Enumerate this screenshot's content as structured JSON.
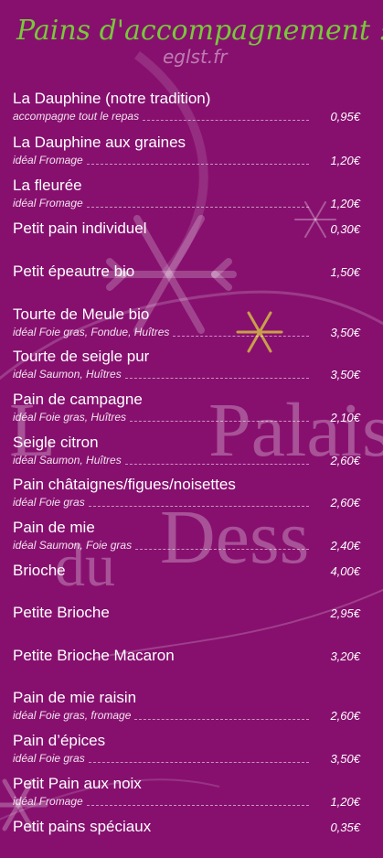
{
  "header": {
    "title": "Pains d'accompagnement :",
    "watermark": "eglst.fr"
  },
  "background_text": {
    "line1": "Palais",
    "line2": "du",
    "line3": "Dess"
  },
  "colors": {
    "background": "#87106f",
    "title": "#78c83a",
    "text": "#ffffff"
  },
  "items": [
    {
      "name": "La Dauphine (notre tradition)",
      "desc": "accompagne tout le repas",
      "price": "0,95€"
    },
    {
      "name": "La Dauphine aux graines",
      "desc": "idéal Fromage",
      "price": "1,20€"
    },
    {
      "name": "La fleurée",
      "desc": "idéal Fromage",
      "price": "1,20€"
    },
    {
      "name": "Petit pain individuel",
      "desc": "",
      "price": "0,30€"
    },
    {
      "name": "Petit épeautre bio",
      "desc": "",
      "price": "1,50€"
    },
    {
      "name": "Tourte de Meule bio",
      "desc": "idéal Foie gras, Fondue, Huîtres",
      "price": "3,50€"
    },
    {
      "name": "Tourte de seigle pur",
      "desc": "idéal Saumon, Huîtres",
      "price": "3,50€"
    },
    {
      "name": "Pain de campagne",
      "desc": "idéal Foie gras, Huîtres",
      "price": "2,10€"
    },
    {
      "name": "Seigle citron",
      "desc": "idéal Saumon, Huîtres",
      "price": "2,60€"
    },
    {
      "name": "Pain châtaignes/figues/noisettes",
      "desc": "idéal Foie gras",
      "price": "2,60€"
    },
    {
      "name": "Pain de mie",
      "desc": "idéal Saumon, Foie gras",
      "price": "2,40€"
    },
    {
      "name": "Brioche",
      "desc": "",
      "price": "4,00€"
    },
    {
      "name": "Petite Brioche",
      "desc": "",
      "price": "2,95€"
    },
    {
      "name": "Petite Brioche Macaron",
      "desc": "",
      "price": "3,20€"
    },
    {
      "name": "Pain de mie raisin",
      "desc": "idéal Foie gras, fromage",
      "price": "2,60€"
    },
    {
      "name": "Pain d’épices",
      "desc": "idéal Foie gras",
      "price": "3,50€"
    },
    {
      "name": "Petit Pain aux noix",
      "desc": "idéal Fromage",
      "price": "1,20€"
    },
    {
      "name": "Petit pains spéciaux",
      "desc": "",
      "price": "0,35€"
    }
  ]
}
